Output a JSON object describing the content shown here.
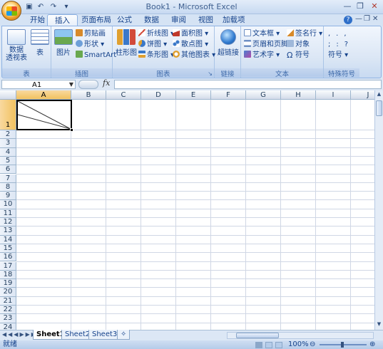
{
  "window": {
    "title": "Book1 - Microsoft Excel"
  },
  "tabs": [
    "开始",
    "插入",
    "页面布局",
    "公式",
    "数据",
    "审阅",
    "视图",
    "加载项"
  ],
  "active_tab": "插入",
  "ribbon": {
    "tables": {
      "label": "表",
      "pivot": "数据\n透视表",
      "table": "表"
    },
    "illustrations": {
      "label": "插图",
      "picture": "图片",
      "clipart": "剪贴画",
      "shapes": "形状",
      "smartart": "SmartArt"
    },
    "charts": {
      "label": "图表",
      "column": "柱形图",
      "line": "折线图",
      "pie": "饼图",
      "bar": "条形图",
      "area": "面积图",
      "scatter": "散点图",
      "other": "其他图表"
    },
    "links": {
      "label": "链接",
      "hyperlink": "超链接"
    },
    "text": {
      "label": "文本",
      "textbox": "文本框",
      "header_footer": "页眉和页脚",
      "wordart": "艺术字",
      "signature": "签名行",
      "object": "对象",
      "symbol": "符号"
    },
    "special": {
      "label": "特殊符号",
      "symbol": "符号"
    }
  },
  "formula_bar": {
    "name_box": "A1",
    "fx": "fx",
    "formula": ""
  },
  "columns": [
    "A",
    "B",
    "C",
    "D",
    "E",
    "F",
    "G",
    "H",
    "I",
    "J"
  ],
  "rows": [
    "1",
    "2",
    "3",
    "4",
    "5",
    "6",
    "7",
    "8",
    "9",
    "10",
    "11",
    "12",
    "13",
    "14",
    "15",
    "16",
    "17",
    "18",
    "19",
    "20",
    "21",
    "22",
    "23",
    "24"
  ],
  "selected_cell": "A1",
  "sheets": [
    "Sheet1",
    "Sheet2",
    "Sheet3"
  ],
  "active_sheet": "Sheet1",
  "status": {
    "ready": "就绪",
    "zoom": "100%"
  },
  "colors": {
    "accent": "#15428b",
    "selection": "#f1c15f"
  }
}
